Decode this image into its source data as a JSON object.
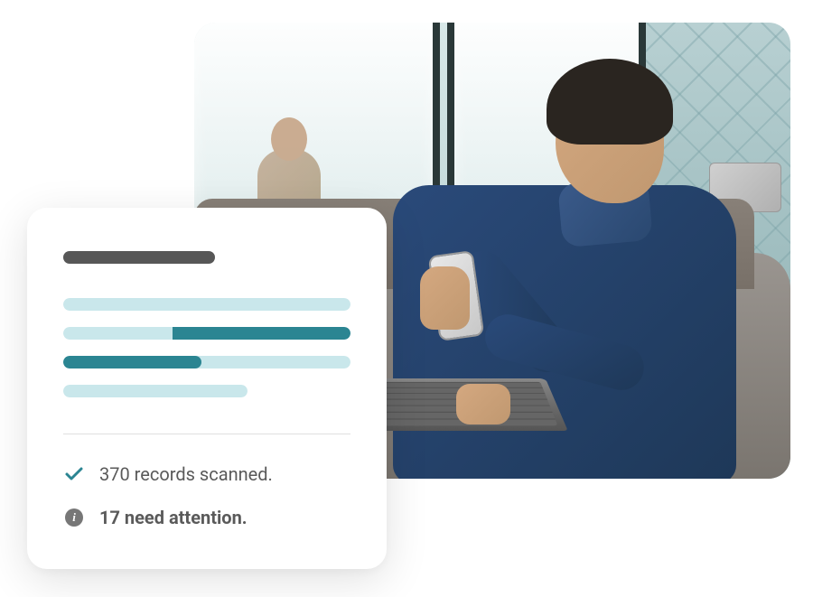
{
  "card": {
    "status": {
      "scanned": {
        "count": 370,
        "text": "370 records scanned."
      },
      "attention": {
        "count": 17,
        "text": "17 need attention."
      }
    }
  },
  "chart_data": {
    "type": "bar",
    "orientation": "horizontal",
    "note": "Decorative skeleton bars with partial teal fills; values are estimated fill percentages of full bar width.",
    "series": [
      {
        "name": "row-1",
        "bar_width_pct": 100,
        "fill_pct": 0
      },
      {
        "name": "row-2",
        "bar_width_pct": 100,
        "fill_pct": 62,
        "fill_side": "right"
      },
      {
        "name": "row-3",
        "bar_width_pct": 100,
        "fill_pct": 48,
        "fill_side": "left"
      },
      {
        "name": "row-4",
        "bar_width_pct": 64,
        "fill_pct": 0
      }
    ],
    "colors": {
      "track": "#c9e7eb",
      "fill": "#2b8592"
    }
  }
}
